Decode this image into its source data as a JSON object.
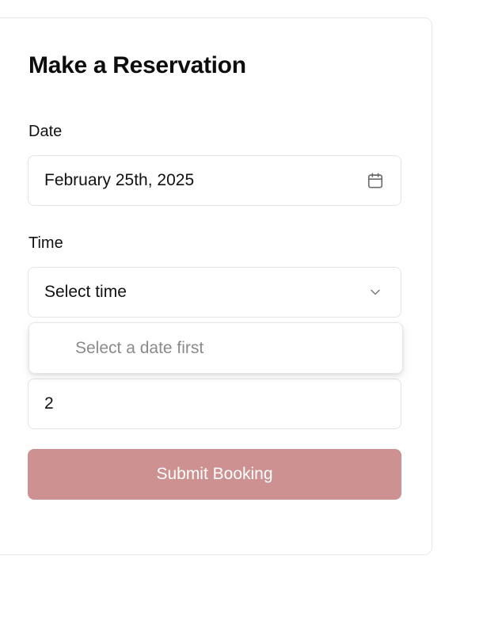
{
  "form": {
    "title": "Make a Reservation",
    "date_label": "Date",
    "date_value": "February 25th, 2025",
    "date_icon": "calendar-icon",
    "time_label": "Time",
    "time_value": "Select time",
    "time_icon": "chevron-down-icon",
    "time_dropdown_message": "Select a date first",
    "guests_value": "2",
    "submit_label": "Submit Booking"
  },
  "colors": {
    "submit_bg": "#cc9190",
    "border": "#e4e4e7",
    "muted_text": "#8a8a8a"
  }
}
